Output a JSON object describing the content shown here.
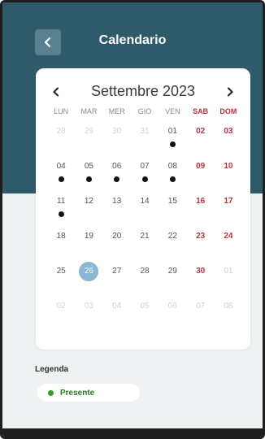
{
  "header": {
    "title": "Calendario"
  },
  "calendar": {
    "month_label": "Settembre 2023",
    "weekdays": [
      "LUN",
      "MAR",
      "MER",
      "GIO",
      "VEN",
      "SAB",
      "DOM"
    ],
    "weeks": [
      [
        {
          "d": "28",
          "other": true
        },
        {
          "d": "29",
          "other": true
        },
        {
          "d": "30",
          "other": true
        },
        {
          "d": "31",
          "other": true
        },
        {
          "d": "01",
          "dot": true
        },
        {
          "d": "02",
          "weekend": true
        },
        {
          "d": "03",
          "weekend": true
        }
      ],
      [
        {
          "d": "04",
          "dot": true
        },
        {
          "d": "05",
          "dot": true
        },
        {
          "d": "06",
          "dot": true
        },
        {
          "d": "07",
          "dot": true
        },
        {
          "d": "08",
          "dot": true
        },
        {
          "d": "09",
          "weekend": true
        },
        {
          "d": "10",
          "weekend": true
        }
      ],
      [
        {
          "d": "11",
          "dot": true
        },
        {
          "d": "12"
        },
        {
          "d": "13"
        },
        {
          "d": "14"
        },
        {
          "d": "15"
        },
        {
          "d": "16",
          "weekend": true
        },
        {
          "d": "17",
          "weekend": true
        }
      ],
      [
        {
          "d": "18"
        },
        {
          "d": "19"
        },
        {
          "d": "20"
        },
        {
          "d": "21"
        },
        {
          "d": "22"
        },
        {
          "d": "23",
          "weekend": true
        },
        {
          "d": "24",
          "weekend": true
        }
      ],
      [
        {
          "d": "25"
        },
        {
          "d": "26",
          "selected": true
        },
        {
          "d": "27"
        },
        {
          "d": "28"
        },
        {
          "d": "29"
        },
        {
          "d": "30",
          "weekend": true
        },
        {
          "d": "01",
          "other": true,
          "weekend": true
        }
      ],
      [
        {
          "d": "02",
          "other": true
        },
        {
          "d": "03",
          "other": true
        },
        {
          "d": "04",
          "other": true
        },
        {
          "d": "05",
          "other": true
        },
        {
          "d": "06",
          "other": true
        },
        {
          "d": "07",
          "other": true,
          "weekend": true
        },
        {
          "d": "08",
          "other": true,
          "weekend": true
        }
      ]
    ]
  },
  "legend": {
    "title": "Legenda",
    "items": [
      {
        "label": "Presente",
        "color": "#2c9e2c"
      }
    ]
  },
  "colors": {
    "header": "#2e5a6a",
    "selected": "#8ab7d3",
    "weekend": "#b8323d",
    "present": "#2c9e2c"
  },
  "icons": {
    "back": "chevron-left-icon",
    "prev": "chevron-left-icon",
    "next": "chevron-right-icon"
  }
}
